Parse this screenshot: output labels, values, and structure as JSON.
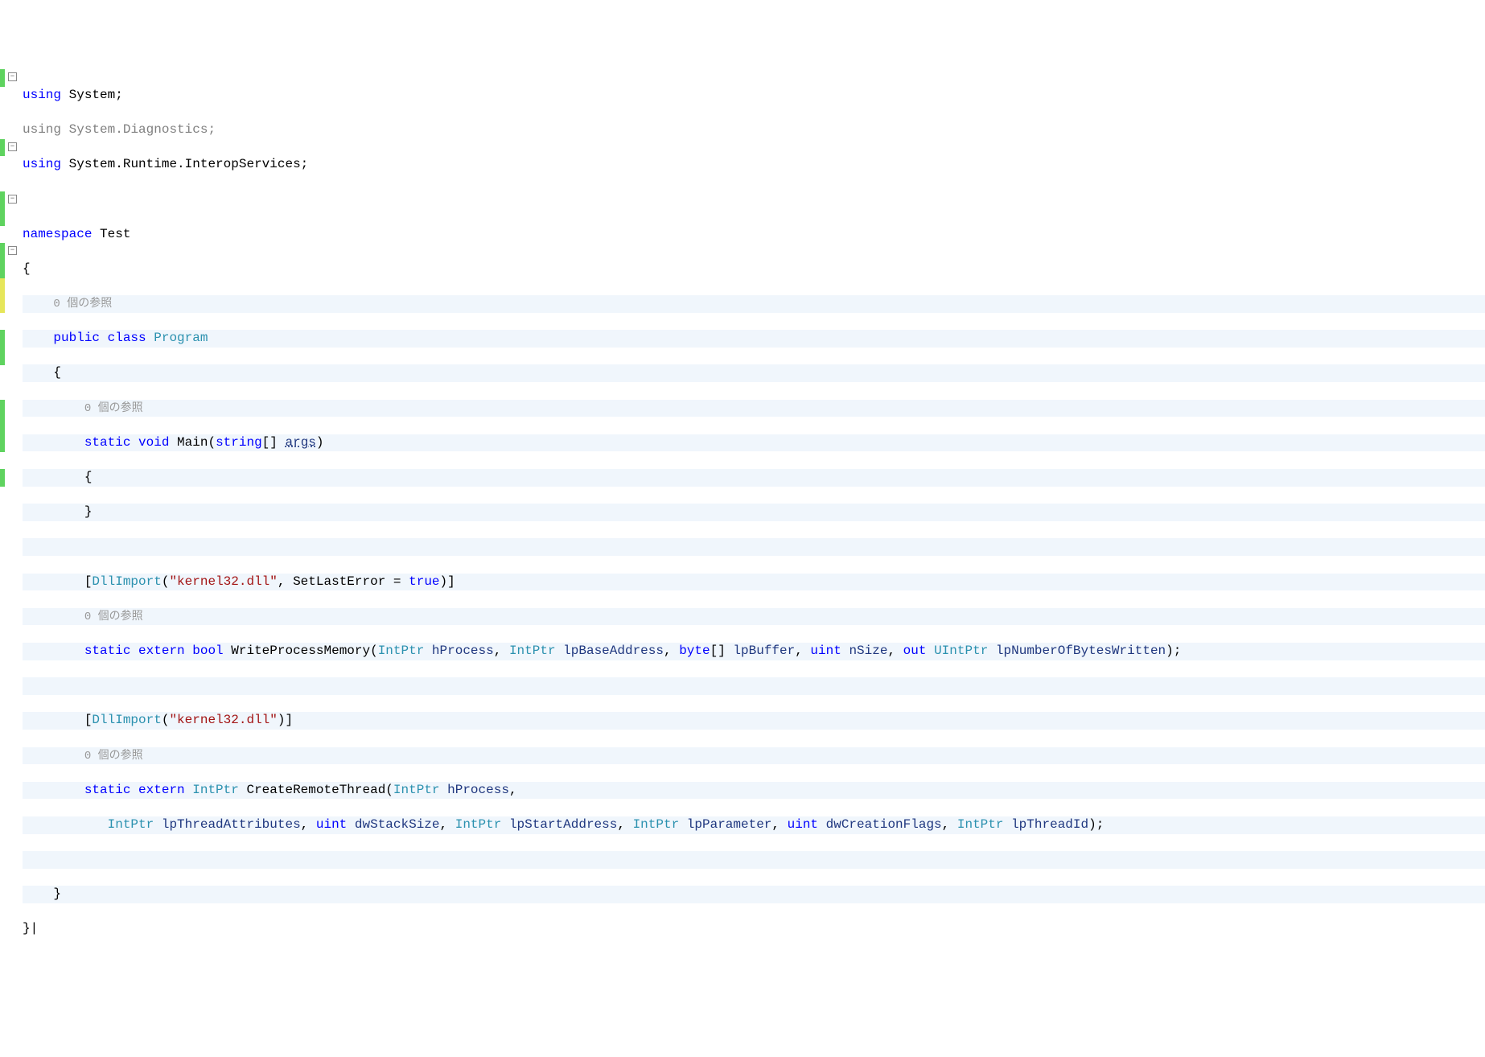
{
  "fold": {
    "minus": "−"
  },
  "code": {
    "l1": {
      "using": "using",
      "ns": "System",
      "semi": ";"
    },
    "l2": {
      "using": "using",
      "ns": "System.Diagnostics",
      "semi": ";"
    },
    "l3": {
      "using": "using",
      "ns": "System.Runtime.InteropServices",
      "semi": ";"
    },
    "l5": {
      "namespace": "namespace",
      "name": "Test"
    },
    "l6": {
      "brace": "{"
    },
    "l7": {
      "ref": "0 個の参照"
    },
    "l8": {
      "public": "public",
      "class": "class",
      "name": "Program"
    },
    "l9": {
      "brace": "{"
    },
    "l10": {
      "ref": "0 個の参照"
    },
    "l11": {
      "static": "static",
      "void": "void",
      "name": "Main",
      "lp": "(",
      "string": "string",
      "brackets": "[]",
      "args": "args",
      "rp": ")"
    },
    "l12": {
      "brace": "{"
    },
    "l13": {
      "brace": "}"
    },
    "l15": {
      "lb": "[",
      "attr": "DllImport",
      "lp": "(",
      "str": "\"kernel32.dll\"",
      "comma": ", ",
      "prop": "SetLastError = ",
      "true": "true",
      "rp": ")",
      "rb": "]"
    },
    "l16": {
      "ref": "0 個の参照"
    },
    "l17": {
      "static": "static",
      "extern": "extern",
      "bool": "bool",
      "name": "WriteProcessMemory",
      "lp": "(",
      "t1": "IntPtr",
      "p1": "hProcess",
      "c1": ", ",
      "t2": "IntPtr",
      "p2": "lpBaseAddress",
      "c2": ", ",
      "t3": "byte",
      "br": "[]",
      "p3": "lpBuffer",
      "c3": ", ",
      "t4": "uint",
      "p4": "nSize",
      "c4": ", ",
      "out": "out",
      "t5": "UIntPtr",
      "p5": "lpNumberOfBytesWritten",
      "rp": ")",
      "semi": ";"
    },
    "l19": {
      "lb": "[",
      "attr": "DllImport",
      "lp": "(",
      "str": "\"kernel32.dll\"",
      "rp": ")",
      "rb": "]"
    },
    "l20": {
      "ref": "0 個の参照"
    },
    "l21": {
      "static": "static",
      "extern": "extern",
      "ret": "IntPtr",
      "name": "CreateRemoteThread",
      "lp": "(",
      "t1": "IntPtr",
      "p1": "hProcess",
      "c1": ","
    },
    "l22": {
      "t1": "IntPtr",
      "p1": "lpThreadAttributes",
      "c1": ", ",
      "t2": "uint",
      "p2": "dwStackSize",
      "c2": ", ",
      "t3": "IntPtr",
      "p3": "lpStartAddress",
      "c3": ", ",
      "t4": "IntPtr",
      "p4": "lpParameter",
      "c4": ", ",
      "t5": "uint",
      "p5": "dwCreationFlags",
      "c5": ", ",
      "t6": "IntPtr",
      "p6": "lpThreadId",
      "rp": ")",
      "semi": ";"
    },
    "l24": {
      "brace": "}"
    },
    "l25": {
      "brace": "}|"
    }
  }
}
